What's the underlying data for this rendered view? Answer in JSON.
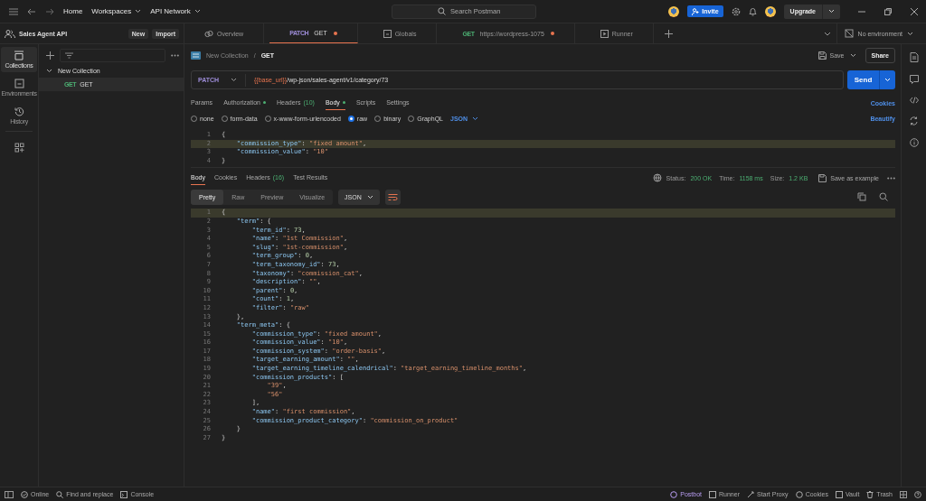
{
  "topbar": {
    "nav": [
      "Home",
      "Workspaces",
      "API Network"
    ],
    "search": {
      "placeholder": "Search Postman"
    },
    "invite": "Invite",
    "upgrade": "Upgrade"
  },
  "tabs": [
    {
      "kind": "overview",
      "label": "Overview",
      "selected": false,
      "unsaved": false
    },
    {
      "kind": "request",
      "method": "PATCH",
      "label": "GET",
      "selected": true,
      "unsaved": true
    },
    {
      "kind": "globals",
      "label": "Globals",
      "selected": false,
      "unsaved": false
    },
    {
      "kind": "request",
      "method": "GET",
      "label": "https://wordpress-1075",
      "selected": false,
      "unsaved": true
    },
    {
      "kind": "runner",
      "label": "Runner",
      "selected": false,
      "unsaved": false
    }
  ],
  "environment": "No environment",
  "workspace": {
    "name": "Sales Agent API",
    "buttons": [
      "New",
      "Import"
    ]
  },
  "rail": [
    {
      "kind": "collections",
      "label": "Collections",
      "selected": true
    },
    {
      "kind": "environments",
      "label": "Environments",
      "selected": false
    },
    {
      "kind": "history",
      "label": "History",
      "selected": false
    },
    {
      "kind": "apps",
      "selected": false
    }
  ],
  "tree": [
    {
      "label": "New Collection",
      "expanded": true,
      "children": [
        {
          "method": "GET",
          "label": "GET",
          "selected": true
        }
      ]
    }
  ],
  "breadcrumb": [
    "New Collection",
    "/",
    "GET"
  ],
  "save": "Save",
  "share": "Share",
  "request": {
    "method": "PATCH",
    "url_var": "{{base_url}}",
    "url": "/wp-json/sales-agent/v1/category/73",
    "send": "Send"
  },
  "request_tabs": [
    {
      "label": "Params",
      "selected": false,
      "dot": false
    },
    {
      "label": "Authorization",
      "selected": false,
      "dot": true
    },
    {
      "label": "Headers",
      "count": "(10)",
      "selected": false,
      "dot": false
    },
    {
      "label": "Body",
      "selected": true,
      "dot": true
    },
    {
      "label": "Scripts",
      "selected": false,
      "dot": false
    },
    {
      "label": "Settings",
      "selected": false,
      "dot": false
    }
  ],
  "cookies_link": "Cookies",
  "body_modes": [
    {
      "label": "none",
      "selected": false
    },
    {
      "label": "form-data",
      "selected": false
    },
    {
      "label": "x-www-form-urlencoded",
      "selected": false
    },
    {
      "label": "raw",
      "selected": true
    },
    {
      "label": "binary",
      "selected": false
    },
    {
      "label": "GraphQL",
      "selected": false
    }
  ],
  "body_format": "JSON",
  "beautify": "Beautify",
  "request_body": [
    {
      "n": "1",
      "text": "{"
    },
    {
      "n": "2",
      "text": "    \"commission_type\": \"fixed amount\",",
      "selected": true
    },
    {
      "n": "3",
      "text": "    \"commission_value\": \"10\""
    },
    {
      "n": "4",
      "text": "}"
    }
  ],
  "response_tabs": [
    {
      "label": "Body",
      "selected": true
    },
    {
      "label": "Cookies",
      "selected": false
    },
    {
      "label": "Headers",
      "count": "(16)",
      "selected": false
    },
    {
      "label": "Test Results",
      "selected": false
    }
  ],
  "status": {
    "status_label": "Status:",
    "status": "200 OK",
    "time_label": "Time:",
    "time": "1158 ms",
    "size_label": "Size:",
    "size": "1.2 KB",
    "save_example": "Save as example"
  },
  "view_modes": [
    {
      "label": "Pretty",
      "selected": true
    },
    {
      "label": "Raw",
      "selected": false
    },
    {
      "label": "Preview",
      "selected": false
    },
    {
      "label": "Visualize",
      "selected": false
    }
  ],
  "response_format": "JSON",
  "response_body": [
    {
      "n": "1",
      "text": "{",
      "selected": true
    },
    {
      "n": "2",
      "text": "    \"term\": {"
    },
    {
      "n": "3",
      "text": "        \"term_id\": 73,"
    },
    {
      "n": "4",
      "text": "        \"name\": \"1st Commission\","
    },
    {
      "n": "5",
      "text": "        \"slug\": \"1st-commission\","
    },
    {
      "n": "6",
      "text": "        \"term_group\": 0,"
    },
    {
      "n": "7",
      "text": "        \"term_taxonomy_id\": 73,"
    },
    {
      "n": "8",
      "text": "        \"taxonomy\": \"commission_cat\","
    },
    {
      "n": "9",
      "text": "        \"description\": \"\","
    },
    {
      "n": "10",
      "text": "        \"parent\": 0,"
    },
    {
      "n": "11",
      "text": "        \"count\": 1,"
    },
    {
      "n": "12",
      "text": "        \"filter\": \"raw\""
    },
    {
      "n": "13",
      "text": "    },"
    },
    {
      "n": "14",
      "text": "    \"term_meta\": {"
    },
    {
      "n": "15",
      "text": "        \"commission_type\": \"fixed amount\","
    },
    {
      "n": "16",
      "text": "        \"commission_value\": \"10\","
    },
    {
      "n": "17",
      "text": "        \"commission_system\": \"order-basis\","
    },
    {
      "n": "18",
      "text": "        \"target_earning_amount\": \"\","
    },
    {
      "n": "19",
      "text": "        \"target_earning_timeline_calendrical\": \"target_earning_timeline_months\","
    },
    {
      "n": "20",
      "text": "        \"commission_products\": ["
    },
    {
      "n": "21",
      "text": "            \"39\","
    },
    {
      "n": "22",
      "text": "            \"56\""
    },
    {
      "n": "23",
      "text": "        ],"
    },
    {
      "n": "24",
      "text": "        \"name\": \"first commission\","
    },
    {
      "n": "25",
      "text": "        \"commission_product_category\": \"commission_on_product\""
    },
    {
      "n": "26",
      "text": "    }"
    },
    {
      "n": "27",
      "text": "}"
    }
  ],
  "statusbar": {
    "left": [
      {
        "kind": "online",
        "label": "Online"
      },
      {
        "kind": "find",
        "label": "Find and replace"
      },
      {
        "kind": "console",
        "label": "Console"
      }
    ],
    "right": [
      {
        "kind": "postbot",
        "label": "Postbot"
      },
      {
        "kind": "runner",
        "label": "Runner"
      },
      {
        "kind": "proxy",
        "label": "Start Proxy"
      },
      {
        "kind": "cookies",
        "label": "Cookies"
      },
      {
        "kind": "vault",
        "label": "Vault"
      },
      {
        "kind": "trash",
        "label": "Trash"
      }
    ]
  }
}
